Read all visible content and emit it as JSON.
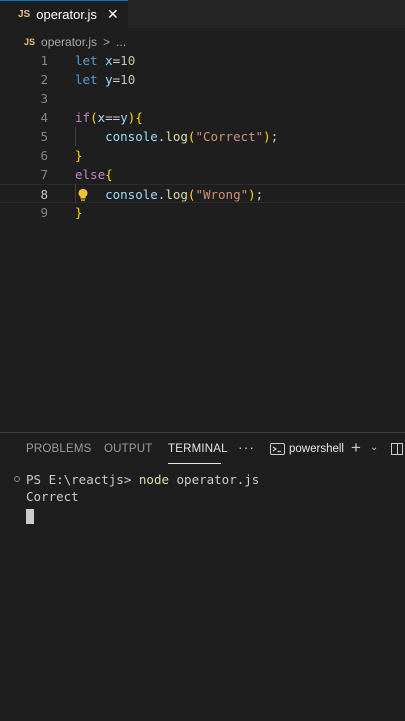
{
  "tab": {
    "badge": "JS",
    "title": "operator.js",
    "close": "✕"
  },
  "breadcrumb": {
    "badge": "JS",
    "file": "operator.js",
    "sep": ">",
    "more": "..."
  },
  "editor": {
    "lines": [
      {
        "num": "1",
        "tokens": [
          [
            "kw",
            "let"
          ],
          [
            "op",
            " "
          ],
          [
            "id",
            "x"
          ],
          [
            "op",
            "="
          ],
          [
            "num",
            "10"
          ]
        ]
      },
      {
        "num": "2",
        "tokens": [
          [
            "kw",
            "let"
          ],
          [
            "op",
            " "
          ],
          [
            "id",
            "y"
          ],
          [
            "op",
            "="
          ],
          [
            "num",
            "10"
          ]
        ]
      },
      {
        "num": "3",
        "tokens": []
      },
      {
        "num": "4",
        "tokens": [
          [
            "ctrl",
            "if"
          ],
          [
            "brk",
            "("
          ],
          [
            "id",
            "x"
          ],
          [
            "op",
            "=="
          ],
          [
            "id",
            "y"
          ],
          [
            "brk",
            ")"
          ],
          [
            "brk",
            "{"
          ]
        ]
      },
      {
        "num": "5",
        "tokens": [
          [
            "op",
            "    "
          ],
          [
            "obj",
            "console"
          ],
          [
            "op",
            "."
          ],
          [
            "fn",
            "log"
          ],
          [
            "brk",
            "("
          ],
          [
            "str",
            "\"Correct\""
          ],
          [
            "brk",
            ")"
          ],
          [
            "op",
            ";"
          ]
        ]
      },
      {
        "num": "6",
        "tokens": [
          [
            "brk",
            "}"
          ]
        ]
      },
      {
        "num": "7",
        "tokens": [
          [
            "ctrl",
            "else"
          ],
          [
            "brk",
            "{"
          ]
        ]
      },
      {
        "num": "8",
        "tokens": [
          [
            "op",
            "    "
          ],
          [
            "obj",
            "console"
          ],
          [
            "op",
            "."
          ],
          [
            "fn",
            "log"
          ],
          [
            "brk",
            "("
          ],
          [
            "str",
            "\"Wrong\""
          ],
          [
            "brk",
            ")"
          ],
          [
            "op",
            ";"
          ]
        ],
        "active": true
      },
      {
        "num": "9",
        "tokens": [
          [
            "brk",
            "}"
          ]
        ]
      }
    ]
  },
  "panel": {
    "tabs": [
      "PROBLEMS",
      "OUTPUT",
      "TERMINAL"
    ],
    "active_tab": "TERMINAL",
    "more": "···",
    "shell": "powershell",
    "plus": "+",
    "chevron": "⌄"
  },
  "terminal": {
    "prompt": "PS E:\\reactjs> ",
    "command": "node",
    "args": " operator.js",
    "output": "Correct"
  },
  "colors": {
    "accent": "#007acc",
    "background": "#1e1e1e",
    "js_badge": "#e5c07b"
  }
}
